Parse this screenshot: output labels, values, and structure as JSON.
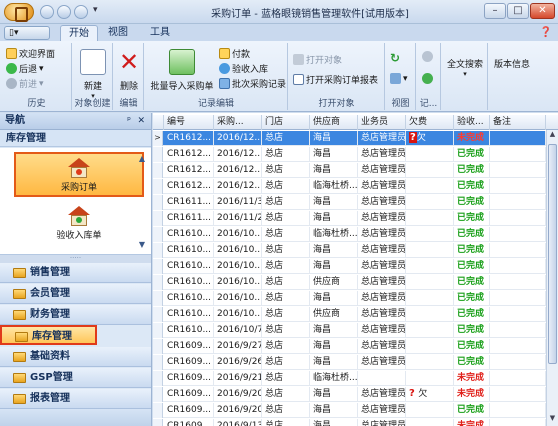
{
  "window": {
    "title": "采购订单 - 蓝格眼镜销售管理软件[试用版本]",
    "minimize": "–",
    "maximize": "□",
    "close": "✕"
  },
  "tabs": {
    "menu_label": "▯▾",
    "items": [
      "开始",
      "视图",
      "工具"
    ],
    "help_glyph": "❓"
  },
  "ribbon": {
    "history": {
      "label": "历史",
      "items": [
        "欢迎界面",
        "后退",
        "前进"
      ]
    },
    "create": {
      "label": "对象创建",
      "button": "新建"
    },
    "edit": {
      "label": "编辑",
      "button": "删除"
    },
    "record_edit": {
      "label": "记录编辑",
      "big_button": "批量导入采购单",
      "items": [
        "付款",
        "验收入库",
        "批次采购记录"
      ]
    },
    "open_object": {
      "label": "打开对象",
      "items": [
        "打开对象",
        "打开采购订单报表"
      ]
    },
    "view": {
      "label": "视图"
    },
    "records": {
      "label": "记..."
    },
    "search": {
      "button": "全文搜索"
    },
    "about": {
      "button": "版本信息"
    }
  },
  "nav": {
    "header": "导航",
    "pin": "ᵖ",
    "close": "✕",
    "section": "库存管理",
    "panel_items": [
      "采购订单",
      "验收入库单"
    ],
    "groups": [
      "销售管理",
      "会员管理",
      "财务管理",
      "库存管理",
      "基础资料",
      "GSP管理",
      "报表管理"
    ],
    "splitter": "·····"
  },
  "grid": {
    "columns": [
      "编号",
      "采购...",
      "门店",
      "供应商",
      "业务员",
      "欠费",
      "验收...",
      "备注"
    ],
    "rows": [
      {
        "id": "CR1612...",
        "date": "2016/12...",
        "store": "总店",
        "supplier": "海昌",
        "staff": "总店管理员",
        "owe": "欠",
        "status": "未完成",
        "selected": true
      },
      {
        "id": "CR1612...",
        "date": "2016/12...",
        "store": "总店",
        "supplier": "海昌",
        "staff": "总店管理员",
        "owe": "",
        "status": "已完成",
        "selected": false
      },
      {
        "id": "CR1612...",
        "date": "2016/12...",
        "store": "总店",
        "supplier": "海昌",
        "staff": "总店管理员",
        "owe": "",
        "status": "已完成",
        "selected": false
      },
      {
        "id": "CR1612...",
        "date": "2016/12...",
        "store": "总店",
        "supplier": "临海杜桥...",
        "staff": "总店管理员",
        "owe": "",
        "status": "已完成",
        "selected": false
      },
      {
        "id": "CR1611...",
        "date": "2016/11/3",
        "store": "总店",
        "supplier": "海昌",
        "staff": "总店管理员",
        "owe": "",
        "status": "已完成",
        "selected": false
      },
      {
        "id": "CR1611...",
        "date": "2016/11/2",
        "store": "总店",
        "supplier": "海昌",
        "staff": "总店管理员",
        "owe": "",
        "status": "已完成",
        "selected": false
      },
      {
        "id": "CR1610...",
        "date": "2016/10...",
        "store": "总店",
        "supplier": "临海杜桥...",
        "staff": "总店管理员",
        "owe": "",
        "status": "已完成",
        "selected": false
      },
      {
        "id": "CR1610...",
        "date": "2016/10...",
        "store": "总店",
        "supplier": "海昌",
        "staff": "总店管理员",
        "owe": "",
        "status": "已完成",
        "selected": false
      },
      {
        "id": "CR1610...",
        "date": "2016/10...",
        "store": "总店",
        "supplier": "海昌",
        "staff": "总店管理员",
        "owe": "",
        "status": "已完成",
        "selected": false
      },
      {
        "id": "CR1610...",
        "date": "2016/10...",
        "store": "总店",
        "supplier": "供应商",
        "staff": "总店管理员",
        "owe": "",
        "status": "已完成",
        "selected": false
      },
      {
        "id": "CR1610...",
        "date": "2016/10...",
        "store": "总店",
        "supplier": "海昌",
        "staff": "总店管理员",
        "owe": "",
        "status": "已完成",
        "selected": false
      },
      {
        "id": "CR1610...",
        "date": "2016/10...",
        "store": "总店",
        "supplier": "供应商",
        "staff": "总店管理员",
        "owe": "",
        "status": "已完成",
        "selected": false
      },
      {
        "id": "CR1610...",
        "date": "2016/10/7",
        "store": "总店",
        "supplier": "海昌",
        "staff": "总店管理员",
        "owe": "",
        "status": "已完成",
        "selected": false
      },
      {
        "id": "CR1609...",
        "date": "2016/9/27",
        "store": "总店",
        "supplier": "海昌",
        "staff": "总店管理员",
        "owe": "",
        "status": "已完成",
        "selected": false
      },
      {
        "id": "CR1609...",
        "date": "2016/9/26",
        "store": "总店",
        "supplier": "海昌",
        "staff": "总店管理员",
        "owe": "",
        "status": "已完成",
        "selected": false
      },
      {
        "id": "CR1609...",
        "date": "2016/9/21",
        "store": "总店",
        "supplier": "临海杜桥...",
        "staff": "",
        "owe": "",
        "status": "未完成",
        "selected": false
      },
      {
        "id": "CR1609...",
        "date": "2016/9/20",
        "store": "总店",
        "supplier": "海昌",
        "staff": "总店管理员",
        "owe": "欠",
        "status": "未完成",
        "selected": false
      },
      {
        "id": "CR1609...",
        "date": "2016/9/20",
        "store": "总店",
        "supplier": "海昌",
        "staff": "总店管理员",
        "owe": "",
        "status": "已完成",
        "selected": false
      },
      {
        "id": "CR1609...",
        "date": "2016/9/13",
        "store": "总店",
        "supplier": "海昌",
        "staff": "总店管理员",
        "owe": "",
        "status": "未完成",
        "selected": false
      }
    ]
  },
  "colors": {
    "accent": "#3b86e0",
    "done": "#19a019",
    "todo": "#e0201a",
    "highlight_border": "#e03a1a"
  }
}
